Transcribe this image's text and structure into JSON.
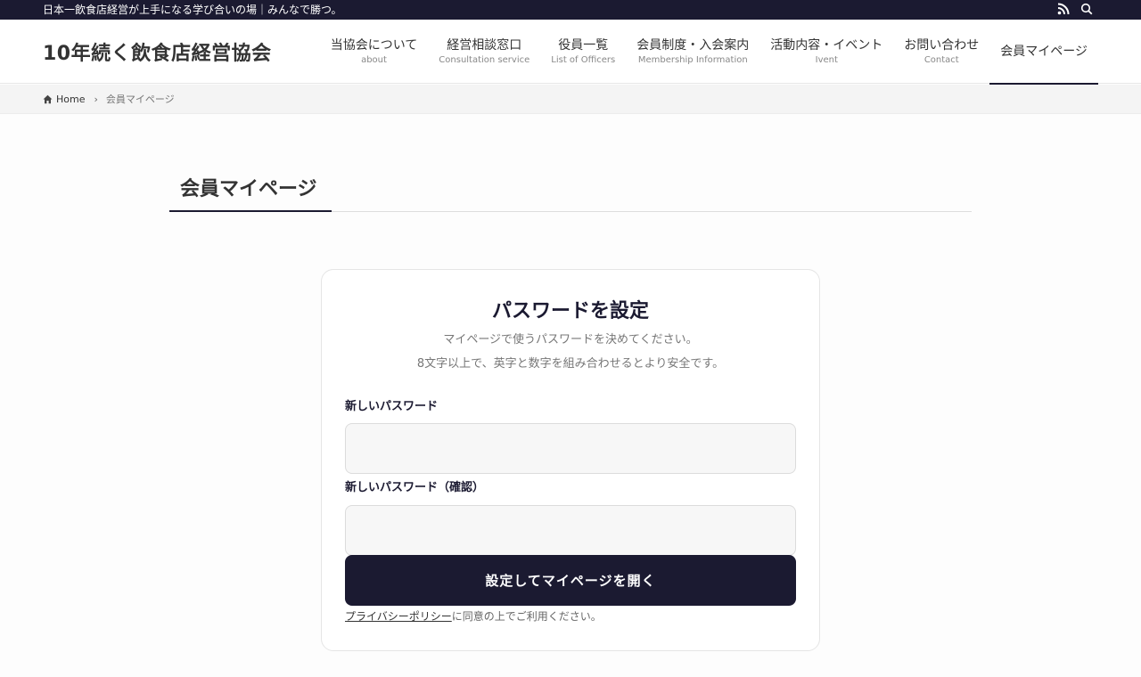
{
  "topbar": {
    "tagline": "日本一飲食店経営が上手になる学び合いの場｜みんなで勝つ。",
    "icons": [
      "rss-icon",
      "search-icon"
    ]
  },
  "header": {
    "site_title": "10年続く飲食店経営協会",
    "nav": [
      {
        "ja": "当協会について",
        "en": "about"
      },
      {
        "ja": "経営相談窓口",
        "en": "Consultation service"
      },
      {
        "ja": "役員一覧",
        "en": "List of Officers"
      },
      {
        "ja": "会員制度・入会案内",
        "en": "Membership Information"
      },
      {
        "ja": "活動内容・イベント",
        "en": "Ivent"
      },
      {
        "ja": "お問い合わせ",
        "en": "Contact"
      },
      {
        "ja": "会員マイページ",
        "en": ""
      }
    ]
  },
  "breadcrumb": {
    "home": "Home",
    "current": "会員マイページ"
  },
  "page": {
    "title": "会員マイページ"
  },
  "form": {
    "title": "パスワードを設定",
    "desc1": "マイページで使うパスワードを決めてください。",
    "desc2": "8文字以上で、英字と数字を組み合わせるとより安全です。",
    "label_new": "新しいパスワード",
    "label_confirm": "新しいパスワード（確認）",
    "value_new": "",
    "value_confirm": "",
    "submit_label": "設定してマイページを開く",
    "privacy_link": "プライバシーポリシー",
    "privacy_suffix": "に同意の上でご利用ください。"
  },
  "colors": {
    "accent": "#1b1a31"
  }
}
